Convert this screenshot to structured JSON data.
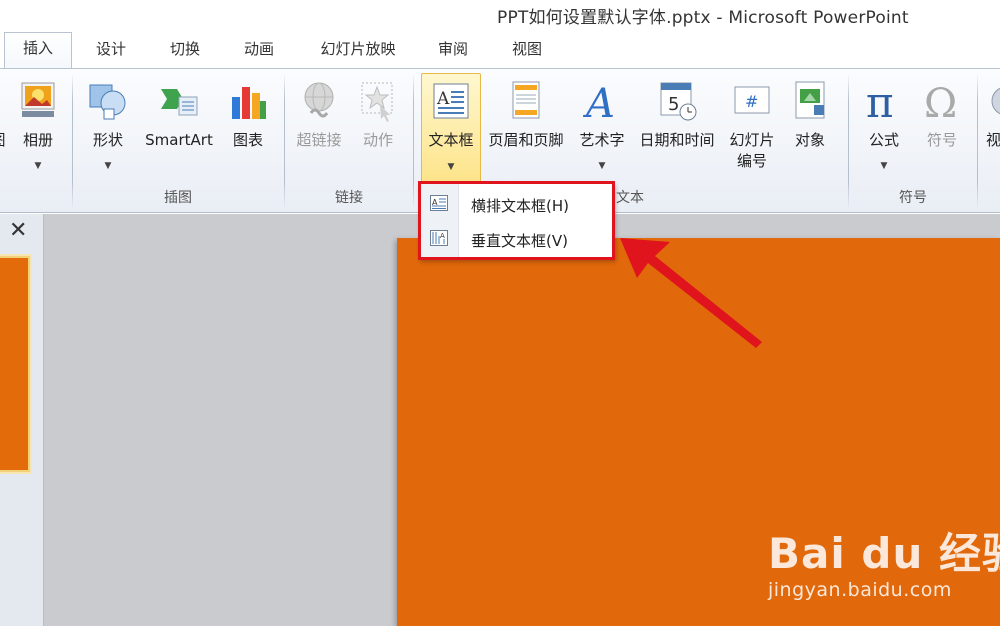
{
  "window": {
    "title": "PPT如何设置默认字体.pptx - Microsoft PowerPoint"
  },
  "tabs": [
    {
      "label": "插入",
      "active": true
    },
    {
      "label": "设计"
    },
    {
      "label": "切换"
    },
    {
      "label": "动画"
    },
    {
      "label": "幻灯片放映"
    },
    {
      "label": "审阅"
    },
    {
      "label": "视图"
    }
  ],
  "ribbon": {
    "groups": [
      {
        "label": "插图"
      },
      {
        "label": "链接"
      },
      {
        "label": "文本"
      },
      {
        "label": "符号"
      }
    ],
    "buttons": {
      "partial_left": "图",
      "album": "相册",
      "shapes": "形状",
      "smartart": "SmartArt",
      "chart": "图表",
      "hyperlink": "超链接",
      "action": "动作",
      "textbox": "文本框",
      "header_footer": "页眉和页脚",
      "wordart": "艺术字",
      "datetime": "日期和时间",
      "slide_number_line1": "幻灯片",
      "slide_number_line2": "编号",
      "object": "对象",
      "equation": "公式",
      "symbol": "符号",
      "partial_right": "视"
    }
  },
  "dropdown": {
    "items": [
      {
        "label": "横排文本框(H)",
        "icon": "horizontal-textbox-icon"
      },
      {
        "label": "垂直文本框(V)",
        "icon": "vertical-textbox-icon"
      }
    ]
  },
  "panel": {
    "close_glyph": "✕"
  },
  "watermark": {
    "logo": "Bai du 经验",
    "url": "jingyan.baidu.com"
  },
  "colors": {
    "slide": "#e1680b",
    "annotation_red": "#e0141d",
    "highlight": "#fde48a"
  }
}
